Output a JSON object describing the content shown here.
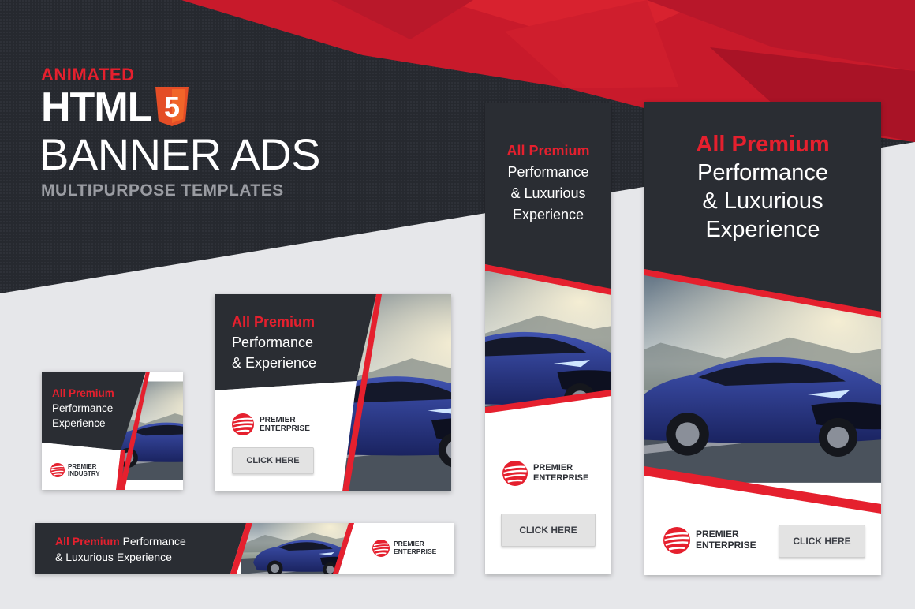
{
  "colors": {
    "accent_red": "#e5202e",
    "dark_panel": "#2a2d33",
    "light_bg": "#e6e7ea",
    "button_gray": "#e3e3e3",
    "car_blue": "#25327a"
  },
  "hero": {
    "animated": "ANIMATED",
    "html": "HTML",
    "html5_badge": "5",
    "banner_ads": "BANNER ADS",
    "multipurpose": "MULTIPURPOSE TEMPLATES"
  },
  "icons": {
    "html5": "html5-shield-icon",
    "logo": "striped-globe-icon"
  },
  "ads": {
    "small_square": {
      "premium": "All Premium",
      "line1": "Performance",
      "line2": "Experience",
      "logo_line1": "PREMIER",
      "logo_line2": "INDUSTRY"
    },
    "medium_rect": {
      "premium": "All Premium",
      "line1": "Performance",
      "line2": "& Experience",
      "logo_line1": "PREMIER",
      "logo_line2": "ENTERPRISE",
      "cta": "CLICK HERE"
    },
    "leaderboard": {
      "premium": "All Premium",
      "line1": " Performance",
      "line2": "& Luxurious Experience",
      "logo_line1": "PREMIER",
      "logo_line2": "ENTERPRISE"
    },
    "skyscraper": {
      "premium": "All Premium",
      "line1": "Performance",
      "line2": "& Luxurious",
      "line3": "Experience",
      "logo_line1": "PREMIER",
      "logo_line2": "ENTERPRISE",
      "cta": "CLICK HERE"
    },
    "half_page": {
      "premium": "All Premium",
      "line1": "Performance",
      "line2": "& Luxurious",
      "line3": "Experience",
      "logo_line1": "PREMIER",
      "logo_line2": "ENTERPRISE",
      "cta": "CLICK HERE"
    }
  }
}
